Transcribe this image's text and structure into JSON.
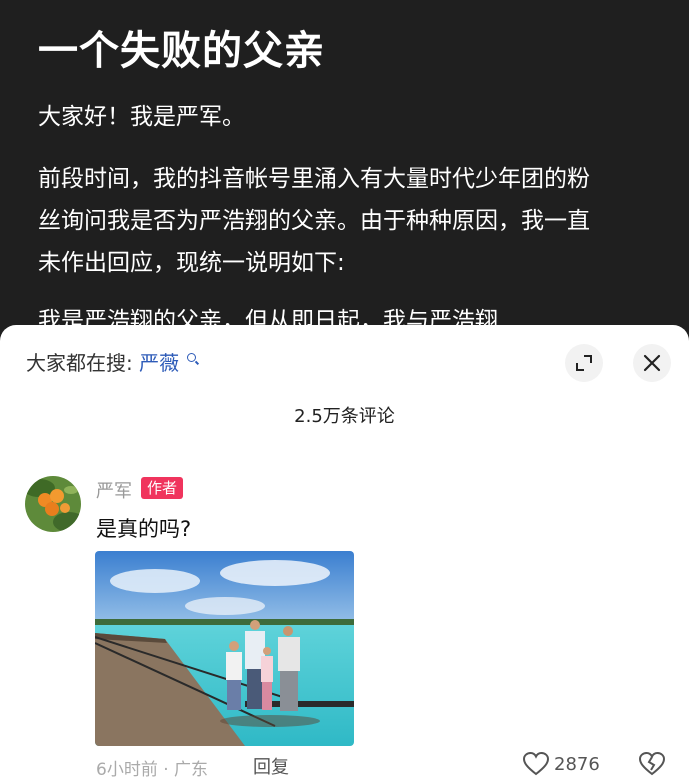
{
  "article": {
    "title": "一个失败的父亲",
    "paragraph1": "大家好！我是严军。",
    "paragraph2": "前段时间，我的抖音帐号里涌入有大量时代少年团的粉丝询问我是否为严浩翔的父亲。由于种种原因，我一直未作出回应，现统一说明如下:",
    "paragraph3": "我是严浩翔的父亲，但从即日起，我与严浩翔"
  },
  "sheet": {
    "search_prefix": "大家都在搜:",
    "search_keyword": "严薇",
    "comment_count": "2.5万条评论"
  },
  "comment": {
    "author": "严军",
    "badge": "作者",
    "text": "是真的吗?",
    "time_location": "6小时前 · 广东",
    "reply_label": "回复",
    "likes": "2876"
  },
  "icons": {
    "search": "search-icon",
    "expand": "expand-icon",
    "close": "close-icon",
    "like": "heart-icon",
    "dislike": "broken-heart-icon"
  },
  "colors": {
    "article_bg": "#1f1f1f",
    "keyword": "#2d5bb8",
    "badge": "#f0345d"
  }
}
